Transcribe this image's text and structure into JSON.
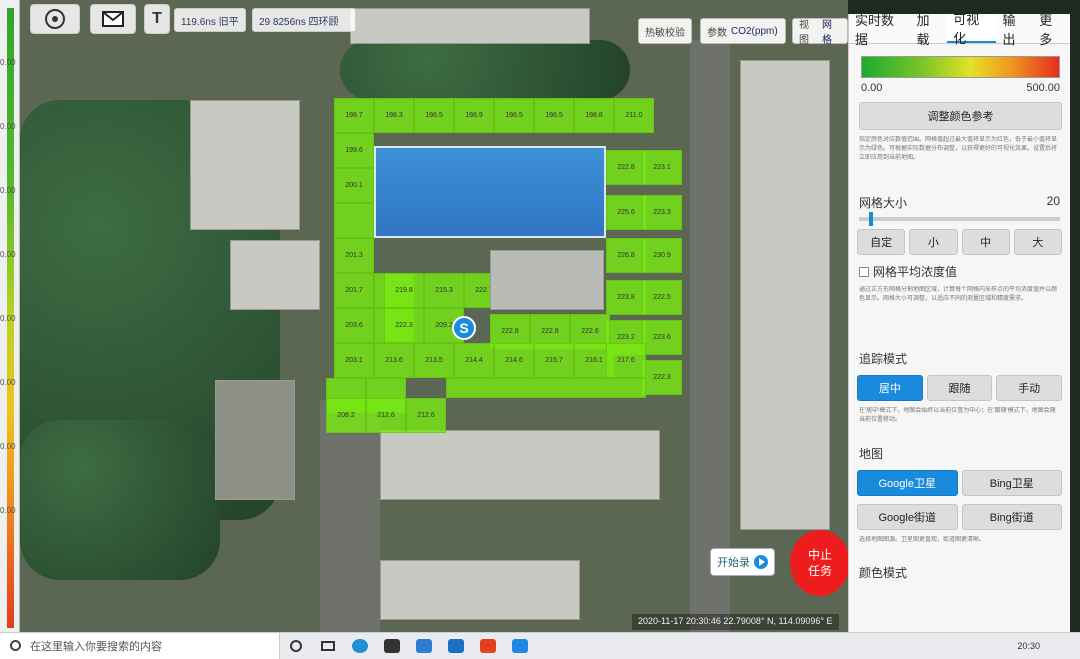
{
  "left_scale": {
    "ticks": [
      "0.00",
      "0.00",
      "0.00",
      "0.00",
      "0.00",
      "0.00",
      "0.00",
      "0.00"
    ]
  },
  "toolbar": {
    "field1_value": "119.6ns 旧平",
    "field2_value": "29 8256ns 四环顾",
    "ctrl_auto": "热敏校验",
    "ctrl_params_label": "参数",
    "ctrl_params_value": "CO2(ppm)",
    "ctrl_view_label": "视图",
    "ctrl_view_value": "网格"
  },
  "grid_values": {
    "row1": [
      "198.7",
      "198.3",
      "198.5",
      "198.9",
      "198.5",
      "198.5",
      "198.8",
      "211.0"
    ],
    "left_col": [
      "199.6",
      "200.1",
      "201.3",
      "201.7",
      "203.6",
      "203.1",
      "208.2"
    ],
    "right_inner": [
      "222.8",
      "225.6",
      "226.8",
      "223.8",
      "223.2",
      "222.8",
      "223.2"
    ],
    "right_outer": [
      "223.1",
      "223.3",
      "230.9",
      "222.5",
      "223.6",
      "222.3"
    ],
    "inner_row1": [
      "219.8",
      "215.3",
      "222.7"
    ],
    "inner_row2": [
      "222.3",
      "209.2",
      "222.8",
      "222.8",
      "222.6"
    ],
    "inner_row3": [
      "213.6",
      "213.5",
      "214.4",
      "214.6",
      "215.7",
      "216.1",
      "217.6"
    ],
    "bottom_row": [
      "212.6",
      "212.6"
    ]
  },
  "map": {
    "marker_label": "S",
    "start_record": "开始录",
    "stop_task_line1": "中止",
    "stop_task_line2": "任务",
    "coords": "2020-11-17 20:30:46   22.79008° N, 114.09096° E"
  },
  "panel": {
    "tabs": [
      "实时数据",
      "加载",
      "可视化",
      "输出",
      "更多"
    ],
    "range_min": "0.00",
    "range_max": "500.00",
    "adjust_color_btn": "调整颜色参考",
    "desc1": "指定颜色对应数值范围。网格值超过最大值将显示为红色，低于最小值将显示为绿色。可根据实际数据分布调整，以获得更好的可视化效果。设置后将立即应用到当前地图。",
    "grid_size_label": "网格大小",
    "grid_size_value": "20",
    "grid_size_level": 0.05,
    "size_btns": [
      "自定",
      "小",
      "中",
      "大"
    ],
    "grid_avg_label": "网格平均浓度值",
    "desc2": "通过正方形网格分割地图区域，计算每个网格内采样点的平均浓度值并以颜色显示。网格大小可调整，以适应不同的测量区域和精度需求。",
    "track_mode_label": "追踪模式",
    "track_btns": [
      "居中",
      "跟随",
      "手动"
    ],
    "desc3": "在'居中'模式下，地图会始终以当前位置为中心；在'跟随'模式下，地图会随当前位置移动。",
    "map_label": "地图",
    "map_btns": [
      "Google卫星",
      "Bing卫星",
      "Google街道",
      "Bing街道"
    ],
    "desc4": "选择地图图源。卫星图更直观，街道图更清晰。",
    "color_mode_label": "颜色模式"
  },
  "taskbar": {
    "search_placeholder": "在这里输入你要搜索的内容",
    "clock": "20:30"
  }
}
